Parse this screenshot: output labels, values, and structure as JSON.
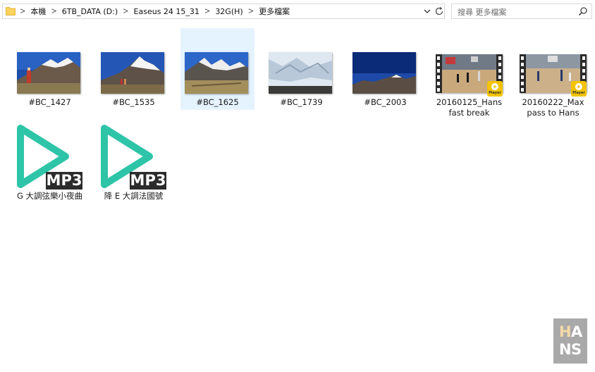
{
  "address_bar": {
    "breadcrumbs": [
      "本機",
      "6TB_DATA (D:)",
      "Easeus 24 15_31",
      "32G(H)",
      "更多檔案"
    ]
  },
  "search": {
    "placeholder": "搜尋 更多檔案"
  },
  "files": [
    {
      "label": "#BC_1427",
      "type": "image",
      "selected": false
    },
    {
      "label": "#BC_1535",
      "type": "image",
      "selected": false
    },
    {
      "label": "#BC_1625",
      "type": "image",
      "selected": true
    },
    {
      "label": "#BC_1739",
      "type": "image",
      "selected": false
    },
    {
      "label": "#BC_2003",
      "type": "image",
      "selected": false
    },
    {
      "label": "20160125_Hans fast break",
      "type": "video",
      "badge": "Player"
    },
    {
      "label": "20160222_Max pass to Hans",
      "type": "video",
      "badge": "Player"
    },
    {
      "label": "G 大調弦樂小夜曲",
      "type": "audio",
      "badge": "MP3"
    },
    {
      "label": "降 E 大調法國號",
      "type": "audio",
      "badge": "MP3"
    }
  ],
  "watermark": {
    "letters": [
      "H",
      "A",
      "N",
      "S"
    ]
  },
  "colors": {
    "selection": "#e5f3ff",
    "mp3_triangle": "#2ec4a8",
    "mp3_badge_bg": "#2b2b2b",
    "logo_bg": "#a9a9a9",
    "logo_letter_h": "#f2d9a8"
  }
}
